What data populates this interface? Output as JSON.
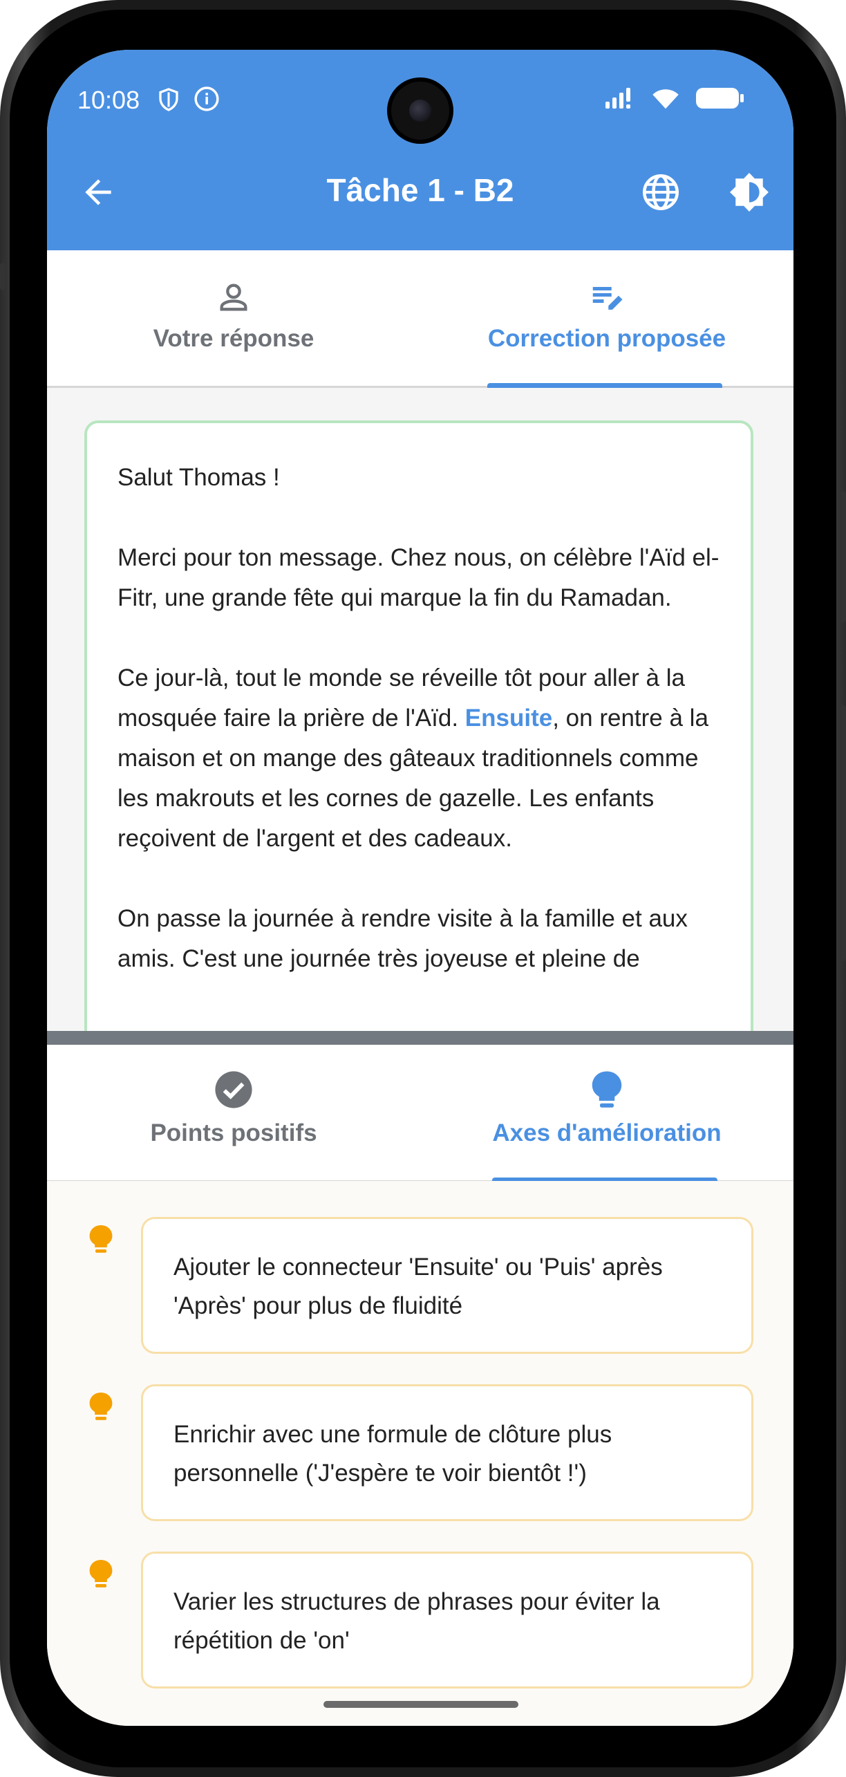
{
  "status_bar": {
    "time": "10:08"
  },
  "header": {
    "title": "Tâche 1 - B2"
  },
  "top_tabs": [
    {
      "label": "Votre réponse",
      "icon": "person-icon",
      "active": false
    },
    {
      "label": "Correction proposée",
      "icon": "edit-note-icon",
      "active": true
    }
  ],
  "correction": {
    "greeting": "Salut Thomas !",
    "para1": "Merci pour ton message. Chez nous, on célèbre l'Aïd el-Fitr, une grande fête qui marque la fin du Ramadan.",
    "para2_before": "Ce jour-là, tout le monde se réveille tôt pour aller à la mosquée faire la prière de l'Aïd. ",
    "para2_highlight": "Ensuite",
    "para2_after": ", on rentre à la maison et on mange des gâteaux traditionnels comme les makrouts et les cornes de gazelle. Les enfants reçoivent de l'argent et des cadeaux.",
    "para3": "On passe la journée à rendre visite à la famille et aux amis. C'est une journée très joyeuse et pleine de"
  },
  "feedback_tabs": [
    {
      "label": "Points positifs",
      "icon": "check-circle-icon",
      "active": false
    },
    {
      "label": "Axes d'amélioration",
      "icon": "lightbulb-icon",
      "active": true
    }
  ],
  "improvements": [
    "Ajouter le connecteur 'Ensuite' ou 'Puis' après 'Après' pour plus de fluidité",
    "Enrichir avec une formule de clôture plus personnelle ('J'espère te voir bientôt !')",
    "Varier les structures de phrases pour éviter la répétition de 'on'"
  ],
  "colors": {
    "primary": "#4a90e2",
    "success_border": "#b8e6c0",
    "tip_border": "#f7dfa8",
    "bulb": "#f5a100"
  }
}
